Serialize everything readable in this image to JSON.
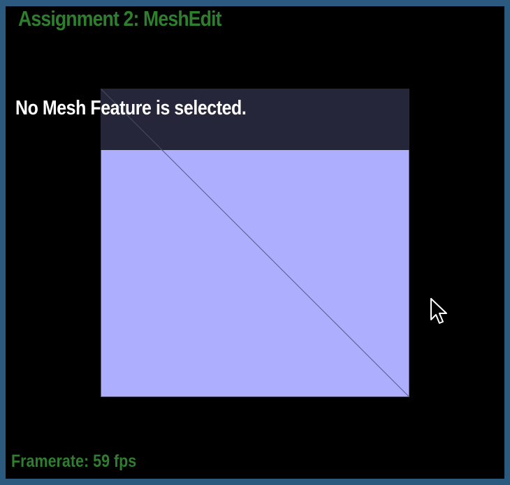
{
  "app": {
    "title": "Assignment 2: MeshEdit"
  },
  "viewport": {
    "background": "#000000",
    "frame_color": "#2b5a7e"
  },
  "mesh": {
    "shape": "square split into two triangles by a diagonal",
    "face_color": "#aeaeff",
    "edge_color": "#5a5a7a"
  },
  "status": {
    "message": "No Mesh Feature is selected."
  },
  "footer": {
    "framerate_text": "Framerate: 59 fps"
  },
  "cursor": {
    "icon": "arrow-cursor-icon"
  },
  "colors": {
    "accent_text": "#2f7d2f",
    "overlay_band": "#26263a"
  }
}
